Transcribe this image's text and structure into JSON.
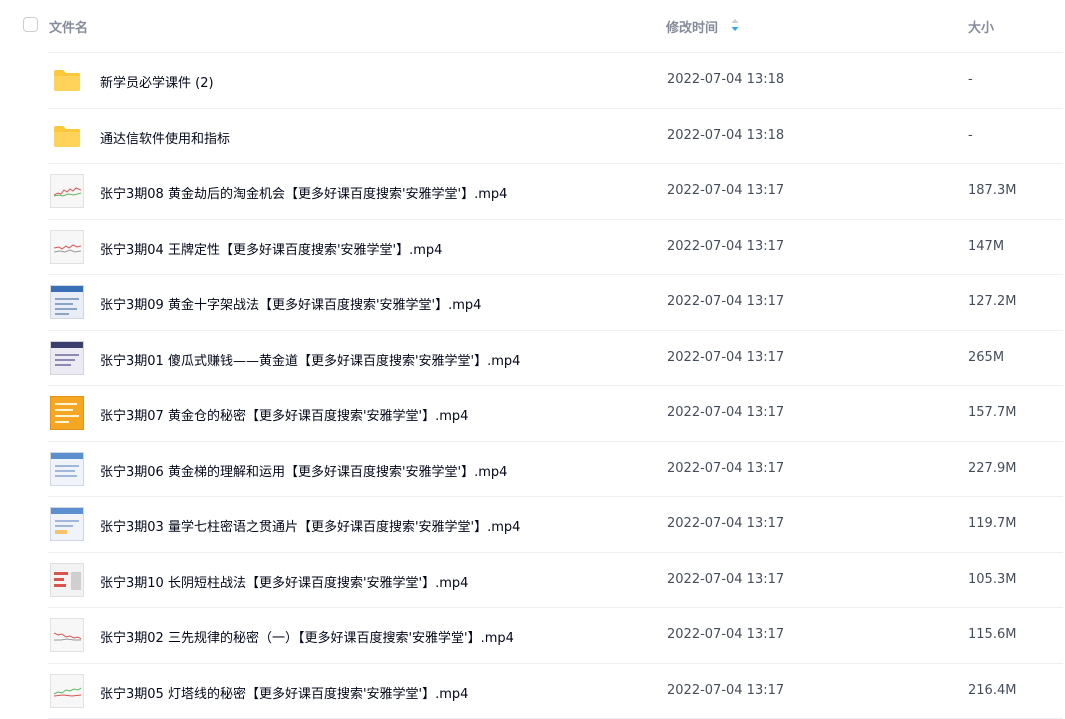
{
  "header": {
    "name_label": "文件名",
    "time_label": "修改时间",
    "size_label": "大小"
  },
  "colors": {
    "folder": "#ffc739",
    "sort_indicator": "#2aa8f0",
    "divider": "#eef0f3"
  },
  "files": [
    {
      "name": "新学员必学课件 (2)",
      "time": "2022-07-04 13:18",
      "size": "-",
      "icon": "folder-icon"
    },
    {
      "name": "通达信软件使用和指标",
      "time": "2022-07-04 13:18",
      "size": "-",
      "icon": "folder-icon"
    },
    {
      "name": "张宁3期08 黄金劫后的淘金机会【更多好课百度搜索'安雅学堂'】.mp4",
      "time": "2022-07-04 13:17",
      "size": "187.3M",
      "icon": "video-thumbnail-chart"
    },
    {
      "name": "张宁3期04 王牌定性【更多好课百度搜索'安雅学堂'】.mp4",
      "time": "2022-07-04 13:17",
      "size": "147M",
      "icon": "video-thumbnail-chart"
    },
    {
      "name": "张宁3期09 黄金十字架战法【更多好课百度搜索'安雅学堂'】.mp4",
      "time": "2022-07-04 13:17",
      "size": "127.2M",
      "icon": "video-thumbnail-slide"
    },
    {
      "name": "张宁3期01 傻瓜式赚钱——黄金道【更多好课百度搜索'安雅学堂'】.mp4",
      "time": "2022-07-04 13:17",
      "size": "265M",
      "icon": "video-thumbnail-slide"
    },
    {
      "name": "张宁3期07 黄金仓的秘密【更多好课百度搜索'安雅学堂'】.mp4",
      "time": "2022-07-04 13:17",
      "size": "157.7M",
      "icon": "video-thumbnail-slide"
    },
    {
      "name": "张宁3期06 黄金梯的理解和运用【更多好课百度搜索'安雅学堂'】.mp4",
      "time": "2022-07-04 13:17",
      "size": "227.9M",
      "icon": "video-thumbnail-slide"
    },
    {
      "name": "张宁3期03 量学七柱密语之贯通片【更多好课百度搜索'安雅学堂'】.mp4",
      "time": "2022-07-04 13:17",
      "size": "119.7M",
      "icon": "video-thumbnail-slide"
    },
    {
      "name": "张宁3期10 长阴短柱战法【更多好课百度搜索'安雅学堂'】.mp4",
      "time": "2022-07-04 13:17",
      "size": "105.3M",
      "icon": "video-thumbnail-slide"
    },
    {
      "name": "张宁3期02 三先规律的秘密（一）【更多好课百度搜索'安雅学堂'】.mp4",
      "time": "2022-07-04 13:17",
      "size": "115.6M",
      "icon": "video-thumbnail-chart"
    },
    {
      "name": "张宁3期05 灯塔线的秘密【更多好课百度搜索'安雅学堂'】.mp4",
      "time": "2022-07-04 13:17",
      "size": "216.4M",
      "icon": "video-thumbnail-chart"
    }
  ]
}
